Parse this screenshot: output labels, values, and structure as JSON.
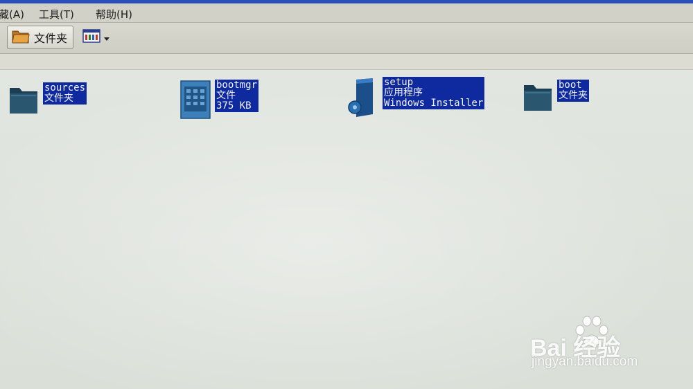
{
  "menu": {
    "favorites": "藏(A)",
    "tools": "工具(T)",
    "help": "帮助(H)"
  },
  "toolbar": {
    "folders_label": "文件夹",
    "folders_icon": "folder-icon",
    "views_icon": "views-icon"
  },
  "files": [
    {
      "name": "sources",
      "lines": [
        "sources",
        "文件夹"
      ],
      "icon": "folder-icon"
    },
    {
      "name": "bootmgr",
      "lines": [
        "bootmgr",
        "文件",
        "375 KB"
      ],
      "icon": "system-file-icon"
    },
    {
      "name": "setup",
      "lines": [
        "setup",
        "应用程序",
        "Windows Installer"
      ],
      "icon": "setup-installer-icon"
    },
    {
      "name": "boot",
      "lines": [
        "boot",
        "文件夹"
      ],
      "icon": "folder-icon"
    }
  ],
  "watermark": {
    "brand": "Bai 经验",
    "url": "jingyan.baidu.com"
  },
  "colors": {
    "selection": "#0e2a9e",
    "selection_text": "#f2f4ff",
    "menubar": "#d2d1c7",
    "content_bg": "#e2e6e0",
    "top_strip": "#2b4fb8"
  }
}
